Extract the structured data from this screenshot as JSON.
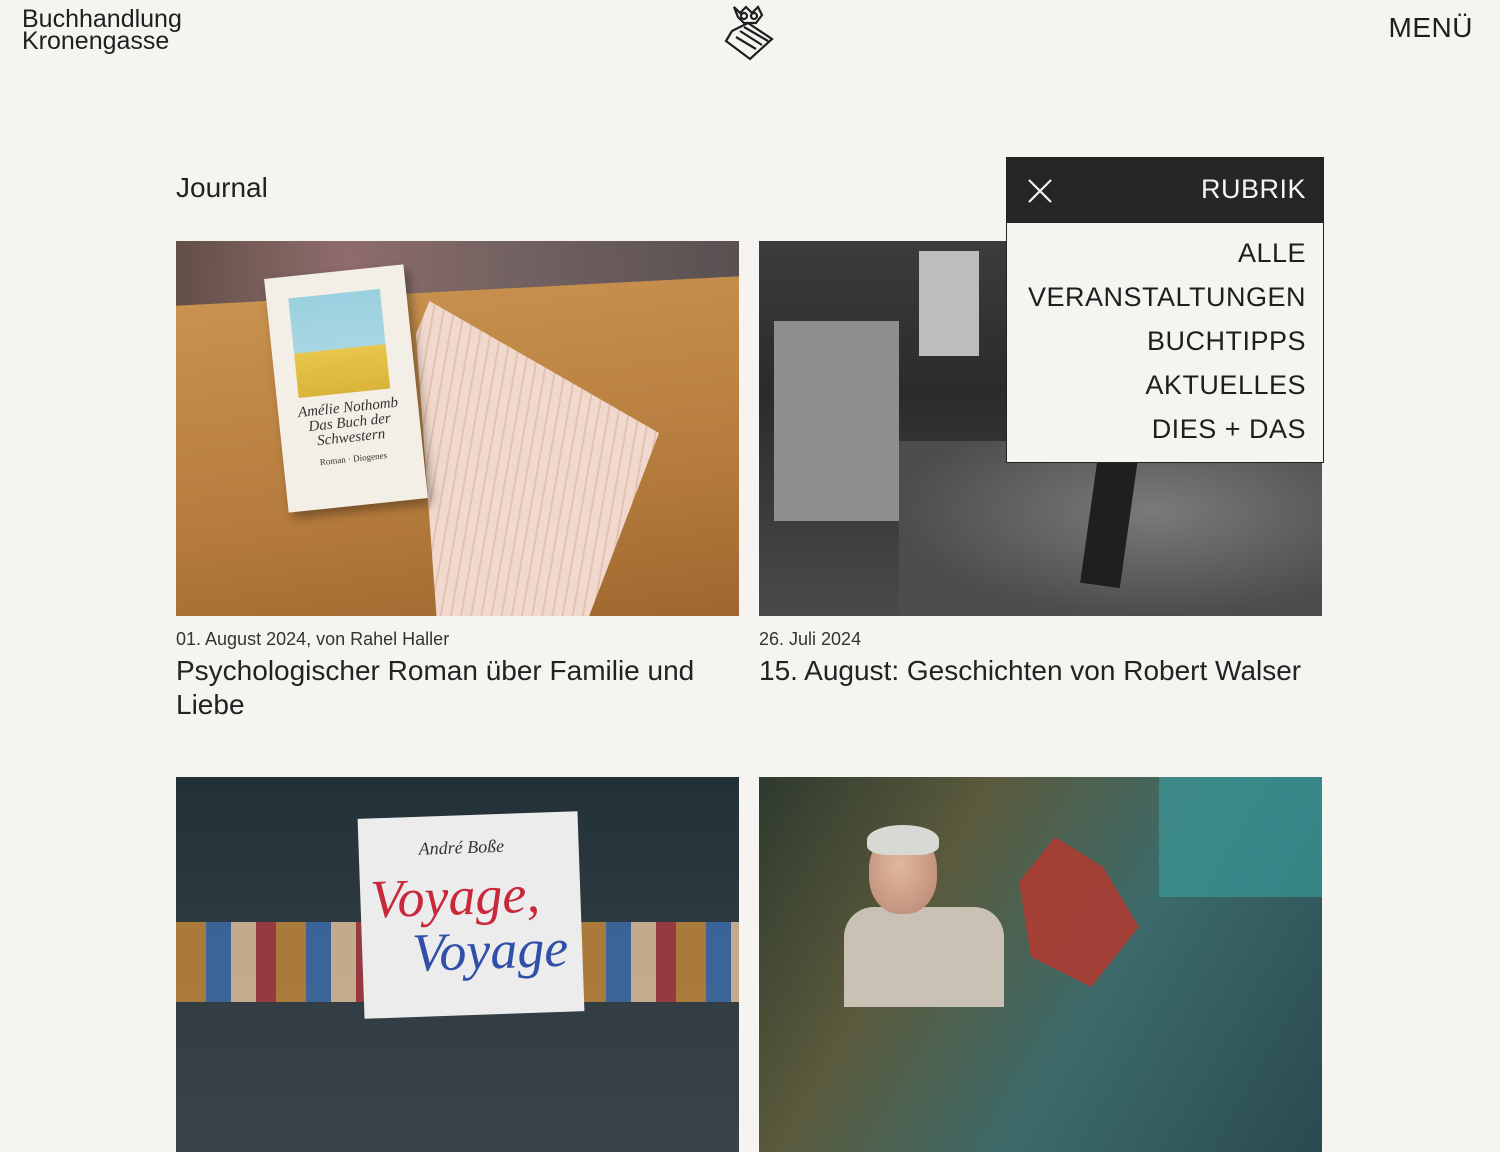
{
  "header": {
    "brand_line1": "Buchhandlung",
    "brand_line2": "Kronengasse",
    "logo_icon": "owl-crown-logo-icon",
    "menu_label": "MENÜ"
  },
  "journal": {
    "title": "Journal"
  },
  "rubrik": {
    "label": "RUBRIK",
    "close_icon": "close-icon",
    "items": [
      "ALLE",
      "VERANSTALTUNGEN",
      "BUCHTIPPS",
      "AKTUELLES",
      "DIES + DAS"
    ]
  },
  "articles": [
    {
      "meta": "01. August 2024, von Rahel Haller",
      "title": "Psychologischer Roman über Familie und Liebe",
      "image_text": {
        "author": "Amélie Nothomb",
        "book": "Das Buch der Schwestern",
        "publisher": "Roman · Diogenes"
      }
    },
    {
      "meta": "26. Juli 2024",
      "title": "15. August: Geschichten von Robert Walser"
    },
    {
      "meta": "",
      "title": "",
      "image_text": {
        "author": "André Boße",
        "line1": "Voyage,",
        "line2": "Voyage"
      }
    },
    {
      "meta": "",
      "title": ""
    }
  ]
}
